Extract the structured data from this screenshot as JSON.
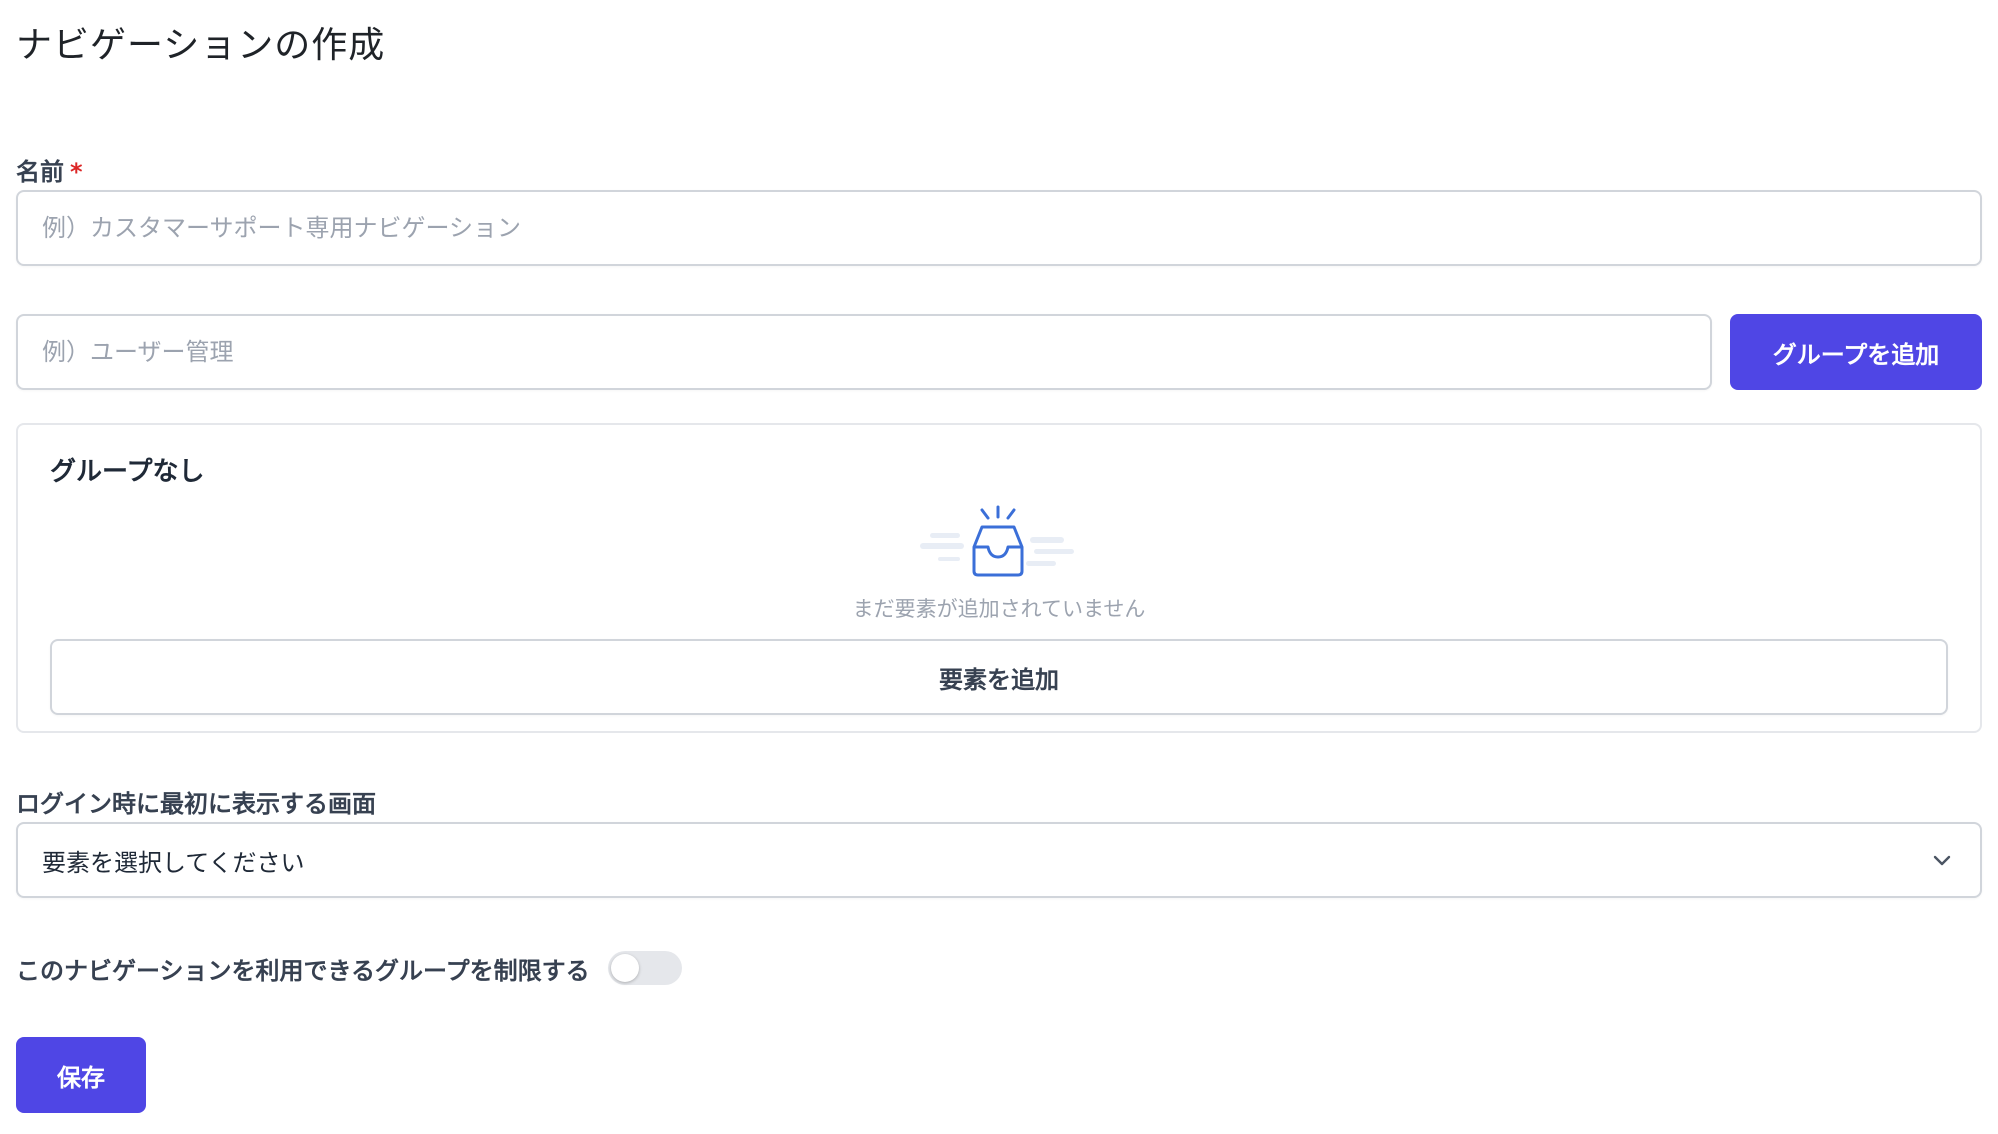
{
  "page": {
    "title": "ナビゲーションの作成"
  },
  "name_field": {
    "label": "名前",
    "required_mark": "*",
    "placeholder": "例）カスタマーサポート専用ナビゲーション",
    "value": ""
  },
  "group_field": {
    "placeholder": "例）ユーザー管理",
    "value": "",
    "add_button_label": "グループを追加"
  },
  "group_panel": {
    "title": "グループなし",
    "empty_icon": "inbox-icon",
    "empty_text": "まだ要素が追加されていません",
    "add_element_label": "要素を追加"
  },
  "initial_screen": {
    "label": "ログイン時に最初に表示する画面",
    "selected_value": "要素を選択してください",
    "chevron_icon": "chevron-down-icon"
  },
  "restriction": {
    "label": "このナビゲーションを利用できるグループを制限する",
    "enabled": false
  },
  "footer": {
    "save_label": "保存"
  },
  "colors": {
    "primary": "#4f46e5",
    "required": "#dc2626",
    "icon_blue": "#3b6fd8"
  }
}
